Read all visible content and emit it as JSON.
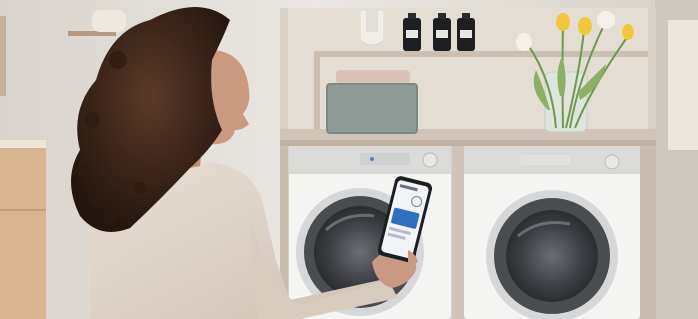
{
  "scene": {
    "palette": {
      "wall": "#e7e3dc",
      "shelf_wood": "#d8cfc4",
      "machine_body": "#f4f4f2",
      "control_panel": "#d9d9d7",
      "door_ring": "#4a4c50",
      "sweater": "#e2d6ca",
      "hair": "#3a2418",
      "skin": "#c99a80",
      "phone_screen": "#2f6fbf",
      "tulip_yellow": "#f1c83a",
      "basket": "#8e9b97"
    },
    "objects": [
      "woman-with-curly-hair",
      "smartphone",
      "washing-machine",
      "tumble-dryer",
      "wooden-shelf-unit",
      "storage-basket",
      "folded-towels",
      "detergent-bottles",
      "tulips-in-glass-vase",
      "wooden-cabinet"
    ]
  }
}
